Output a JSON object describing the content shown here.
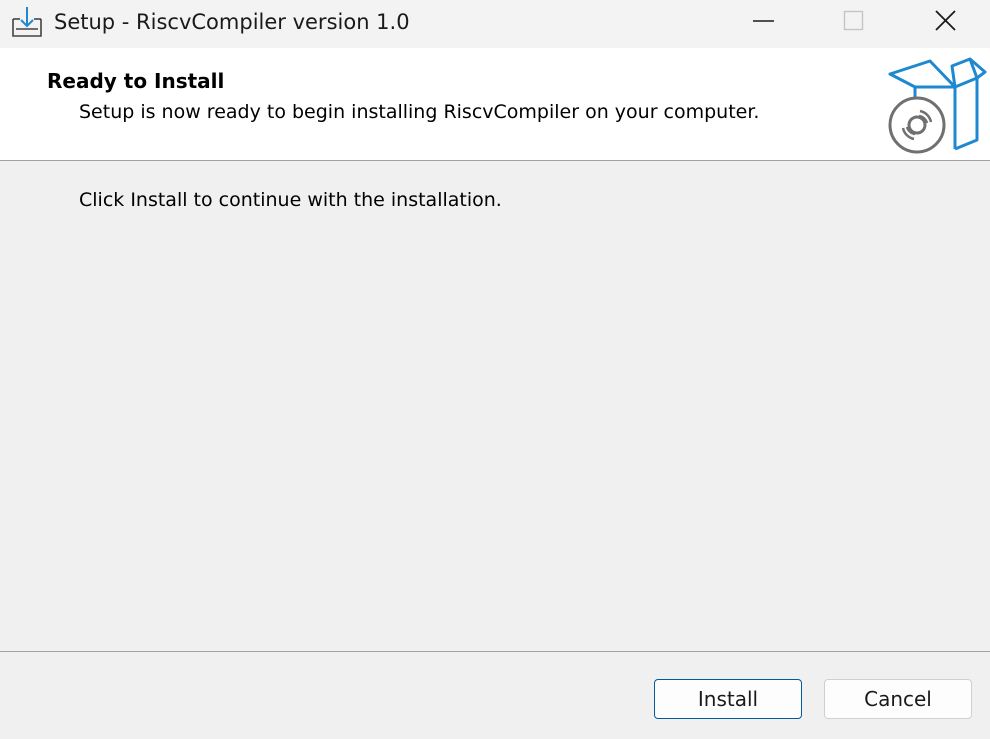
{
  "window": {
    "title": "Setup - RiscvCompiler version 1.0",
    "icons": {
      "app": "installer-download-icon",
      "minimize": "minimize-icon",
      "maximize": "maximize-icon",
      "close": "close-icon"
    }
  },
  "header": {
    "title": "Ready to Install",
    "subtitle": "Setup is now ready to begin installing RiscvCompiler on your computer.",
    "graphic": "software-box-with-disc-icon"
  },
  "body": {
    "message": "Click Install to continue with the installation."
  },
  "footer": {
    "install_label": "Install",
    "cancel_label": "Cancel"
  },
  "colors": {
    "accent_blue": "#1e88d0",
    "disc_gray": "#707070",
    "button_focus_border": "#005a9e"
  }
}
